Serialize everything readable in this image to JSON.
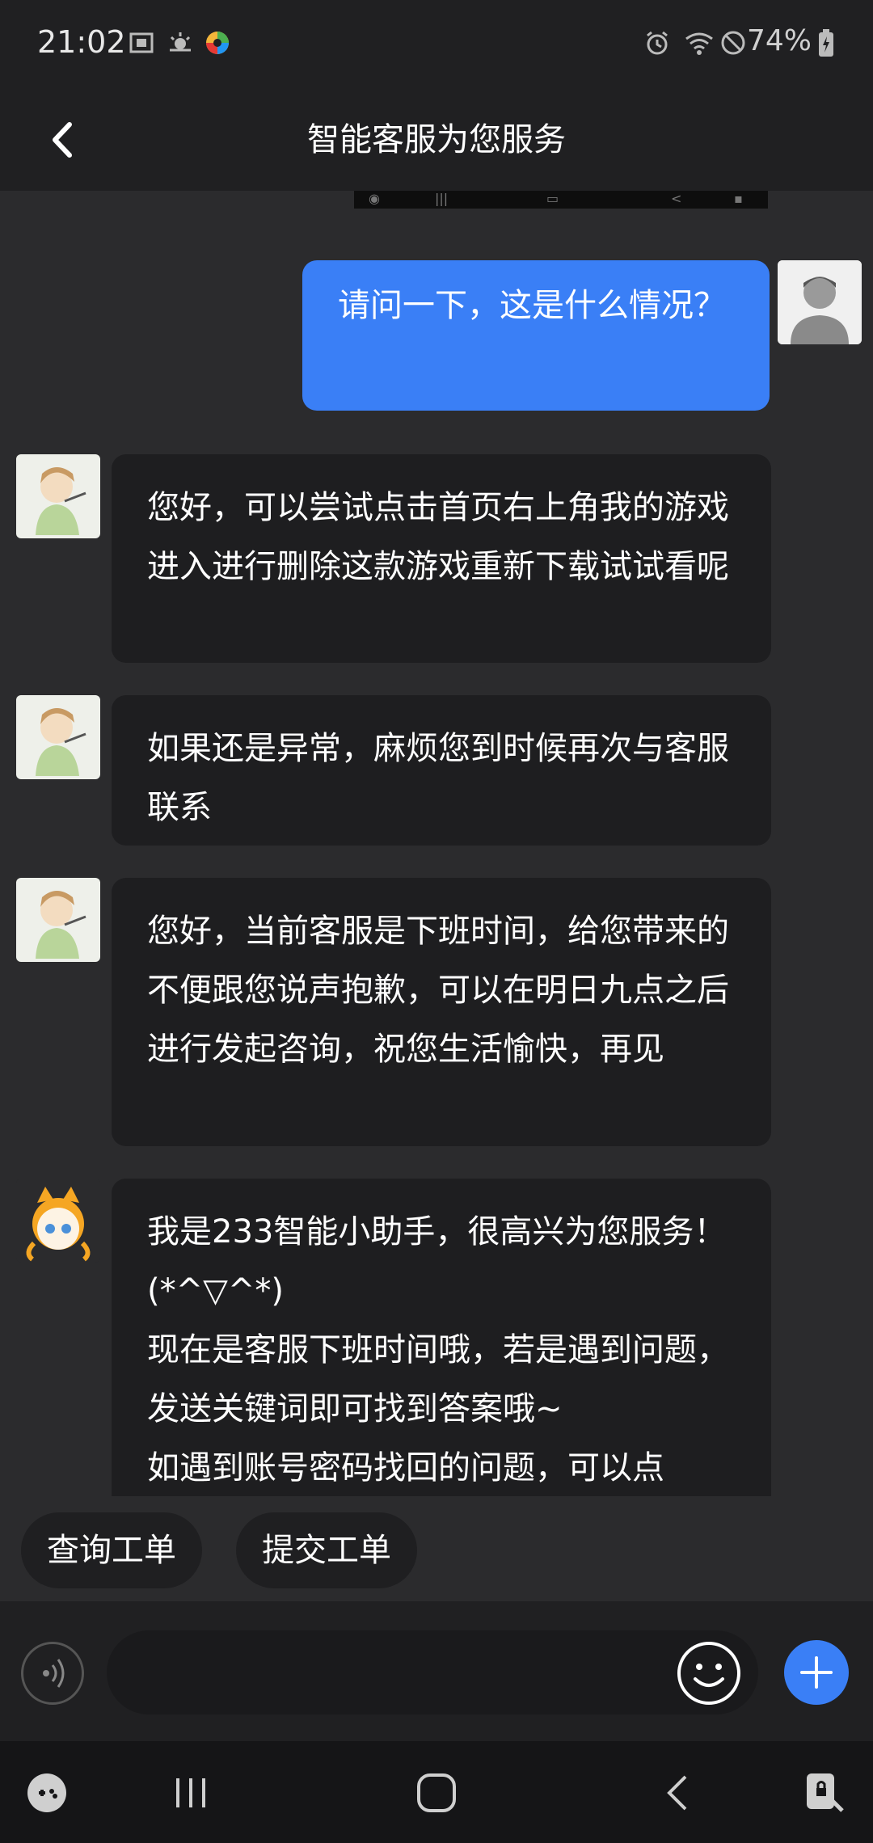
{
  "status_bar": {
    "time": "21:02",
    "battery": "74%",
    "icons": [
      "screenshot-icon",
      "weather-icon",
      "app-color-icon",
      "alarm-icon",
      "wifi-icon",
      "dnd-icon",
      "battery-charging-icon"
    ]
  },
  "header": {
    "title": "智能客服为您服务",
    "back_icon": "chevron-left-icon"
  },
  "messages": [
    {
      "from": "user",
      "text": "请问一下，这是什么情况？"
    },
    {
      "from": "agent",
      "text": "您好，可以尝试点击首页右上角我的游戏进入进行删除这款游戏重新下载试试看呢"
    },
    {
      "from": "agent",
      "text": "如果还是异常，麻烦您到时候再次与客服联系"
    },
    {
      "from": "agent",
      "text": "您好，当前客服是下班时间，给您带来的不便跟您说声抱歉，可以在明日九点之后进行发起咨询，祝您生活愉快，再见"
    },
    {
      "from": "bot",
      "line1": "我是233智能小助手，很高兴为您服务！(*^▽^*)",
      "line2": "现在是客服下班时间哦，若是遇到问题，发送关键词即可找到答案哦~",
      "line3": "如遇到账号密码找回的问题，可以点"
    }
  ],
  "quick_replies": [
    "查询工单",
    "提交工单"
  ],
  "input": {
    "placeholder": ""
  },
  "colors": {
    "accent": "#3a7ff6",
    "bubble_in": "#1e1e20",
    "background": "#2b2b2d"
  }
}
